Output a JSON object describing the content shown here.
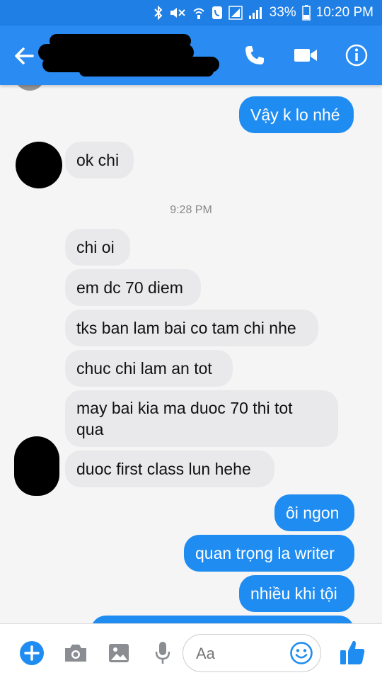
{
  "status": {
    "battery": "33%",
    "time": "10:20 PM"
  },
  "header": {
    "contact_name": ""
  },
  "messages": [
    {
      "dir": "out",
      "text": "Vậy k lo nhé"
    },
    {
      "dir": "in",
      "text": "ok chi"
    },
    {
      "dir": "in",
      "text": "chi oi"
    },
    {
      "dir": "in",
      "text": "em dc 70 diem"
    },
    {
      "dir": "in",
      "text": "tks ban lam bai co tam chi nhe"
    },
    {
      "dir": "in",
      "text": "chuc chi lam an tot"
    },
    {
      "dir": "in",
      "text": "may bai kia ma duoc 70 thi tot"
    },
    {
      "dir": "in",
      "text": "qua"
    },
    {
      "dir": "in",
      "text": "duoc first class lun hehe"
    },
    {
      "dir": "out",
      "text": "ôi ngon"
    },
    {
      "dir": "out",
      "text": "quan trọng la writer"
    },
    {
      "dir": "out",
      "text": "nhiều khi tội"
    }
  ],
  "timestamp": "9:28 PM",
  "composer": {
    "placeholder": "Aa"
  },
  "colors": {
    "header": "#2a8cf2",
    "status_bar": "#1f7fe5",
    "outgoing_bubble": "#1e8cf1",
    "incoming_bubble": "#e9e9eb"
  },
  "icons": [
    "bluetooth-icon",
    "mute-icon",
    "wifi-calling-icon",
    "signal-icon",
    "battery-icon",
    "back-arrow-icon",
    "phone-icon",
    "video-camera-icon",
    "info-icon",
    "plus-icon",
    "camera-icon",
    "gallery-icon",
    "microphone-icon",
    "emoji-icon",
    "thumbs-up-icon"
  ]
}
